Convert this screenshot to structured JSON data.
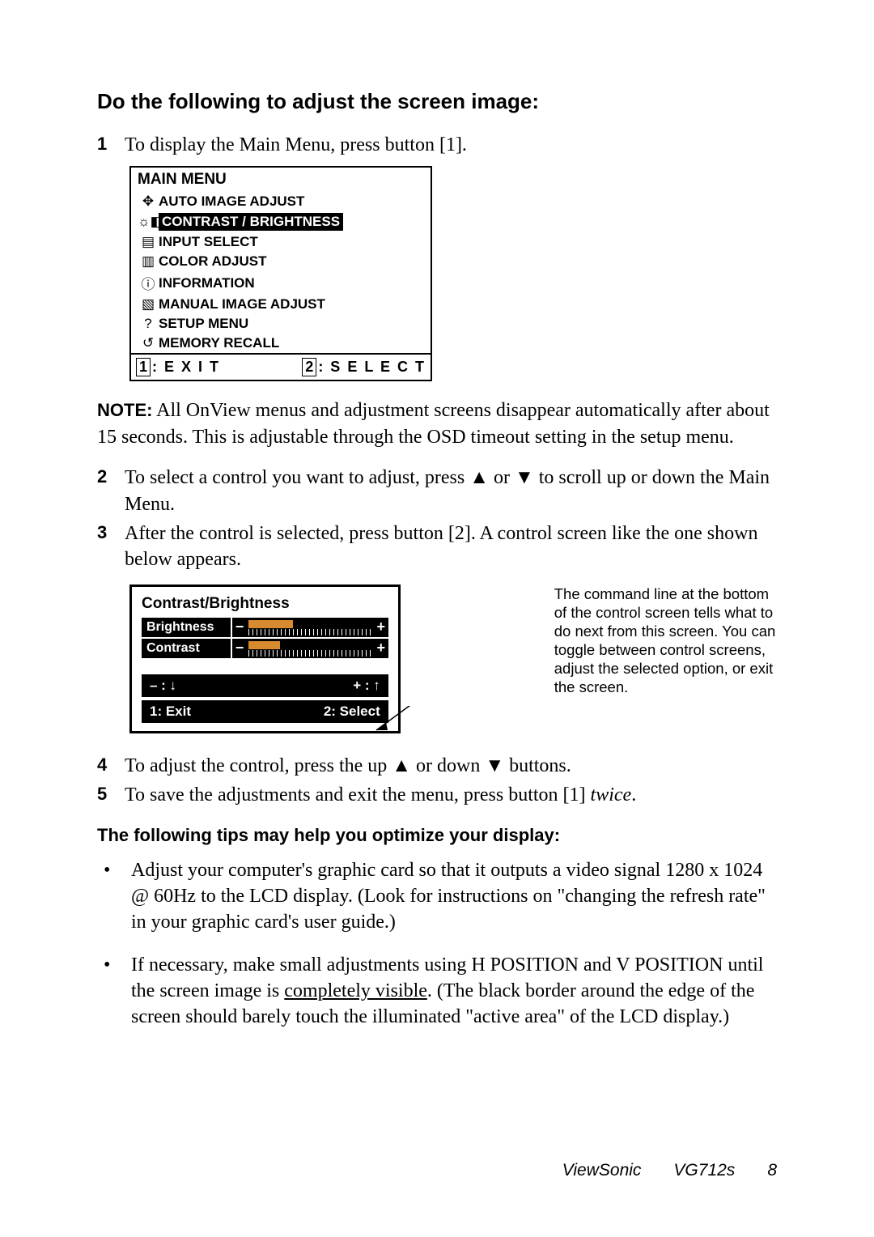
{
  "heading1": "Do the following to adjust the screen image:",
  "steps": {
    "s1_num": "1",
    "s1_text": "To display the Main Menu, press button [1].",
    "s2_num": "2",
    "s2_text": "To select a control you want to adjust, press ▲ or ▼ to scroll up or down the Main Menu.",
    "s3_num": "3",
    "s3_text": "After the control is selected, press button [2]. A control screen like the one shown below appears.",
    "s4_num": "4",
    "s4_text": "To adjust the control, press the up ▲ or down ▼ buttons.",
    "s5_num": "5",
    "s5_text_a": "To save the adjustments and exit the menu, press button [1] ",
    "s5_text_b": "twice",
    "s5_text_c": "."
  },
  "osd": {
    "title": "MAIN MENU",
    "items": [
      {
        "icon": "✥",
        "label": "AUTO IMAGE ADJUST"
      },
      {
        "icon": "☼◧",
        "label": "CONTRAST / BRIGHTNESS"
      },
      {
        "icon": "▤",
        "label": "INPUT SELECT"
      },
      {
        "icon": "▥",
        "label": "COLOR ADJUST"
      },
      {
        "icon": "ⓘ",
        "label": "INFORMATION"
      },
      {
        "icon": "▧",
        "label": "MANUAL IMAGE ADJUST"
      },
      {
        "icon": "?",
        "label": "SETUP MENU"
      },
      {
        "icon": "↺",
        "label": "MEMORY RECALL"
      }
    ],
    "foot_key1": "1",
    "foot_label1": ": E X I T",
    "foot_key2": "2",
    "foot_label2": ": S E L E C T"
  },
  "note_label": "NOTE:",
  "note_text": "  All OnView menus and adjustment screens disappear automatically after about 15 seconds. This is adjustable through the OSD timeout setting in the setup menu.",
  "ctrl": {
    "title": "Contrast/Brightness",
    "row1": "Brightness",
    "row2": "Contrast",
    "minus": "−",
    "plus": "+",
    "foot1_left": "– : ↓",
    "foot1_right": "+ : ↑",
    "foot2_left": "1: Exit",
    "foot2_right": "2: Select"
  },
  "callout": "The command line at the bottom of the control screen tells what to do next from this screen. You can toggle between control screens, adjust the selected option, or exit the screen.",
  "tips_heading": "The following tips may help you optimize your display:",
  "tips": {
    "t1": "Adjust your computer's graphic card so that it outputs a video signal 1280 x 1024 @ 60Hz to the LCD display. (Look for instructions on \"changing the refresh rate\" in your graphic card's user guide.)",
    "t2a": "If necessary, make small adjustments using H POSITION and V POSITION until the screen image is ",
    "t2b": "completely visible",
    "t2c": ". (The black border around the edge of the screen should barely touch the illuminated \"active area\" of the LCD display.)"
  },
  "footer": {
    "brand": "ViewSonic",
    "model": "VG712s",
    "page": "8"
  },
  "chart_data": {
    "type": "bar",
    "title": "Contrast/Brightness slider values (approx.)",
    "categories": [
      "Brightness",
      "Contrast"
    ],
    "values": [
      35,
      25
    ],
    "range": [
      0,
      100
    ]
  }
}
